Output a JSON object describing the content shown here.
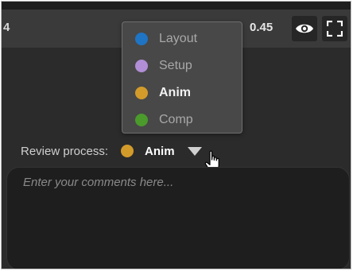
{
  "toolbar": {
    "left_number": "4",
    "value": "0.45",
    "eye_icon": "eye-icon",
    "fullscreen_icon": "fullscreen-icon"
  },
  "dropdown": {
    "items": [
      {
        "label": "Layout",
        "color": "#1f74c4",
        "selected": false
      },
      {
        "label": "Setup",
        "color": "#b18ed6",
        "selected": false
      },
      {
        "label": "Anim",
        "color": "#d39b2a",
        "selected": true
      },
      {
        "label": "Comp",
        "color": "#4b9a2c",
        "selected": false
      }
    ]
  },
  "review": {
    "label": "Review process:",
    "value": "Anim",
    "value_color": "#d39b2a"
  },
  "comments": {
    "placeholder": "Enter your comments here..."
  }
}
